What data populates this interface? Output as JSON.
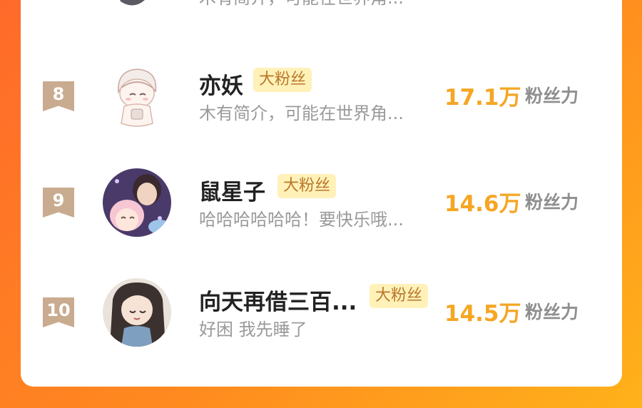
{
  "previous_row": {
    "intro": "木有简介，可能在世界角..."
  },
  "fans": [
    {
      "rank": "8",
      "name": "亦妖",
      "badge": "大粉丝",
      "intro": "木有简介，可能在世界角...",
      "power": "17.1万",
      "power_label": "粉丝力"
    },
    {
      "rank": "9",
      "name": "鼠星子",
      "badge": "大粉丝",
      "intro": "哈哈哈哈哈哈！要快乐哦...",
      "power": "14.6万",
      "power_label": "粉丝力"
    },
    {
      "rank": "10",
      "name": "向天再借三百...",
      "badge": "大粉丝",
      "intro": "好困 我先睡了",
      "power": "14.5万",
      "power_label": "粉丝力"
    }
  ]
}
